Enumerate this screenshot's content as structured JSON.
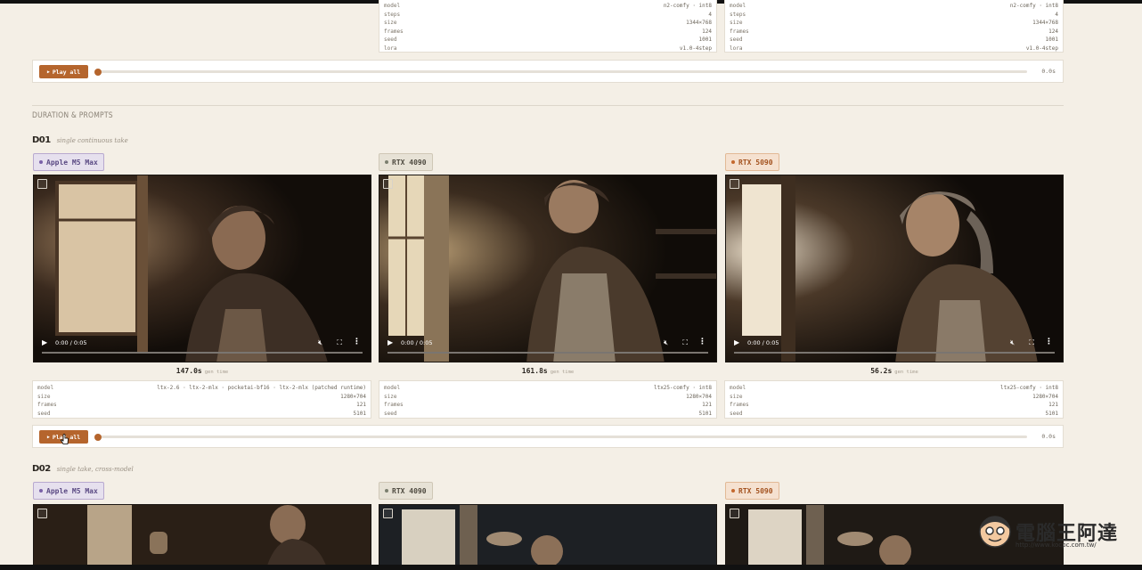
{
  "section": {
    "title": "DURATION & PROMPTS"
  },
  "top_meta": [
    {
      "rows": [
        {
          "k": "model",
          "v": "n2-comfy · int8"
        },
        {
          "k": "steps",
          "v": "4"
        },
        {
          "k": "size",
          "v": "1344×768"
        },
        {
          "k": "frames",
          "v": "124"
        },
        {
          "k": "seed",
          "v": "1001"
        },
        {
          "k": "lora",
          "v": "v1.0-4step"
        }
      ]
    },
    {
      "rows": [
        {
          "k": "model",
          "v": "n2-comfy · int8"
        },
        {
          "k": "steps",
          "v": "4"
        },
        {
          "k": "size",
          "v": "1344×768"
        },
        {
          "k": "frames",
          "v": "124"
        },
        {
          "k": "seed",
          "v": "1001"
        },
        {
          "k": "lora",
          "v": "v1.0-4step"
        }
      ]
    }
  ],
  "playbar_top": {
    "label": "Play all",
    "time": "0.0s",
    "progress": 0
  },
  "take1": {
    "id": "D01",
    "subtitle": "single continuous take",
    "devices": [
      "Apple M5 Max",
      "RTX 4090",
      "RTX 5090"
    ],
    "video_time": "0:00 / 0:05",
    "gen_label": "gen time",
    "gen_times": [
      "147.0s",
      "161.8s",
      "56.2s"
    ],
    "meta": [
      {
        "rows": [
          {
            "k": "model",
            "v": "ltx-2.6 · ltx-2-mlx · pocketai-bf16 · ltx-2-mlx (patched runtime)"
          },
          {
            "k": "size",
            "v": "1280×704"
          },
          {
            "k": "frames",
            "v": "121"
          },
          {
            "k": "seed",
            "v": "5101"
          }
        ]
      },
      {
        "rows": [
          {
            "k": "model",
            "v": "ltx25-comfy · int8"
          },
          {
            "k": "size",
            "v": "1280×704"
          },
          {
            "k": "frames",
            "v": "121"
          },
          {
            "k": "seed",
            "v": "5101"
          }
        ]
      },
      {
        "rows": [
          {
            "k": "model",
            "v": "ltx25-comfy · int8"
          },
          {
            "k": "size",
            "v": "1280×704"
          },
          {
            "k": "frames",
            "v": "121"
          },
          {
            "k": "seed",
            "v": "5101"
          }
        ]
      }
    ],
    "playbar": {
      "label": "Play all",
      "time": "0.0s",
      "progress": 0
    }
  },
  "take2": {
    "id": "D02",
    "subtitle": "single take, cross-model",
    "devices": [
      "Apple M5 Max",
      "RTX 4090",
      "RTX 5090"
    ]
  },
  "watermark": {
    "brand": "電腦王阿達",
    "url": "http://www.kocpc.com.tw/"
  },
  "colors": {
    "accent": "#b5652d",
    "background": "#f4efe6"
  }
}
